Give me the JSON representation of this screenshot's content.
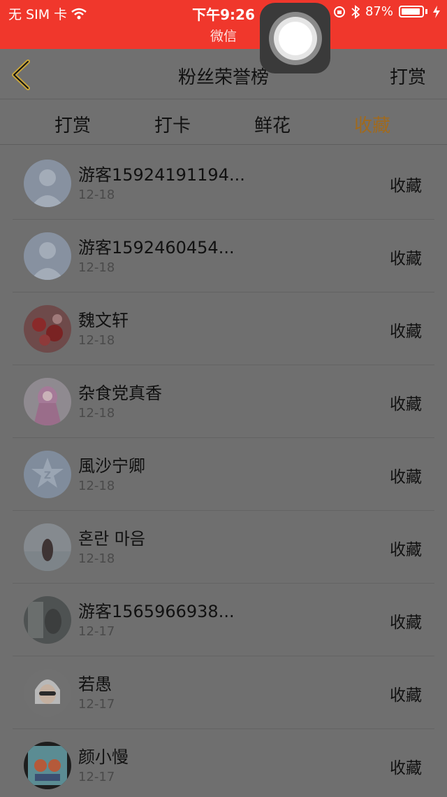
{
  "status_bar": {
    "carrier": "无 SIM 卡",
    "time": "下午9:26",
    "subtitle": "微信",
    "battery": "87%"
  },
  "nav": {
    "title": "粉丝荣誉榜",
    "right_label": "打赏"
  },
  "tabs": [
    {
      "label": "打赏",
      "active": false
    },
    {
      "label": "打卡",
      "active": false
    },
    {
      "label": "鲜花",
      "active": false
    },
    {
      "label": "收藏",
      "active": true
    }
  ],
  "colors": {
    "status_bar": "#f0372c",
    "active_tab": "#a06a1e",
    "overlay_bg": "#6f6f6f"
  },
  "list": [
    {
      "name": "游客15924191194...",
      "date": "12-18",
      "action": "收藏",
      "avatar": "default-user"
    },
    {
      "name": "游客1592460454...",
      "date": "12-18",
      "action": "收藏",
      "avatar": "default-user"
    },
    {
      "name": "魏文轩",
      "date": "12-18",
      "action": "收藏",
      "avatar": "photo-red"
    },
    {
      "name": "杂食党真香",
      "date": "12-18",
      "action": "收藏",
      "avatar": "photo-anime-pink"
    },
    {
      "name": "風沙宁卿",
      "date": "12-18",
      "action": "收藏",
      "avatar": "qq-star-logo"
    },
    {
      "name": "혼란 마음",
      "date": "12-18",
      "action": "收藏",
      "avatar": "photo-beach"
    },
    {
      "name": "游客1565966938...",
      "date": "12-17",
      "action": "收藏",
      "avatar": "photo-dark"
    },
    {
      "name": "若愚",
      "date": "12-17",
      "action": "收藏",
      "avatar": "photo-silver-hair"
    },
    {
      "name": "颜小慢",
      "date": "12-17",
      "action": "收藏",
      "avatar": "photo-cartoon"
    }
  ]
}
